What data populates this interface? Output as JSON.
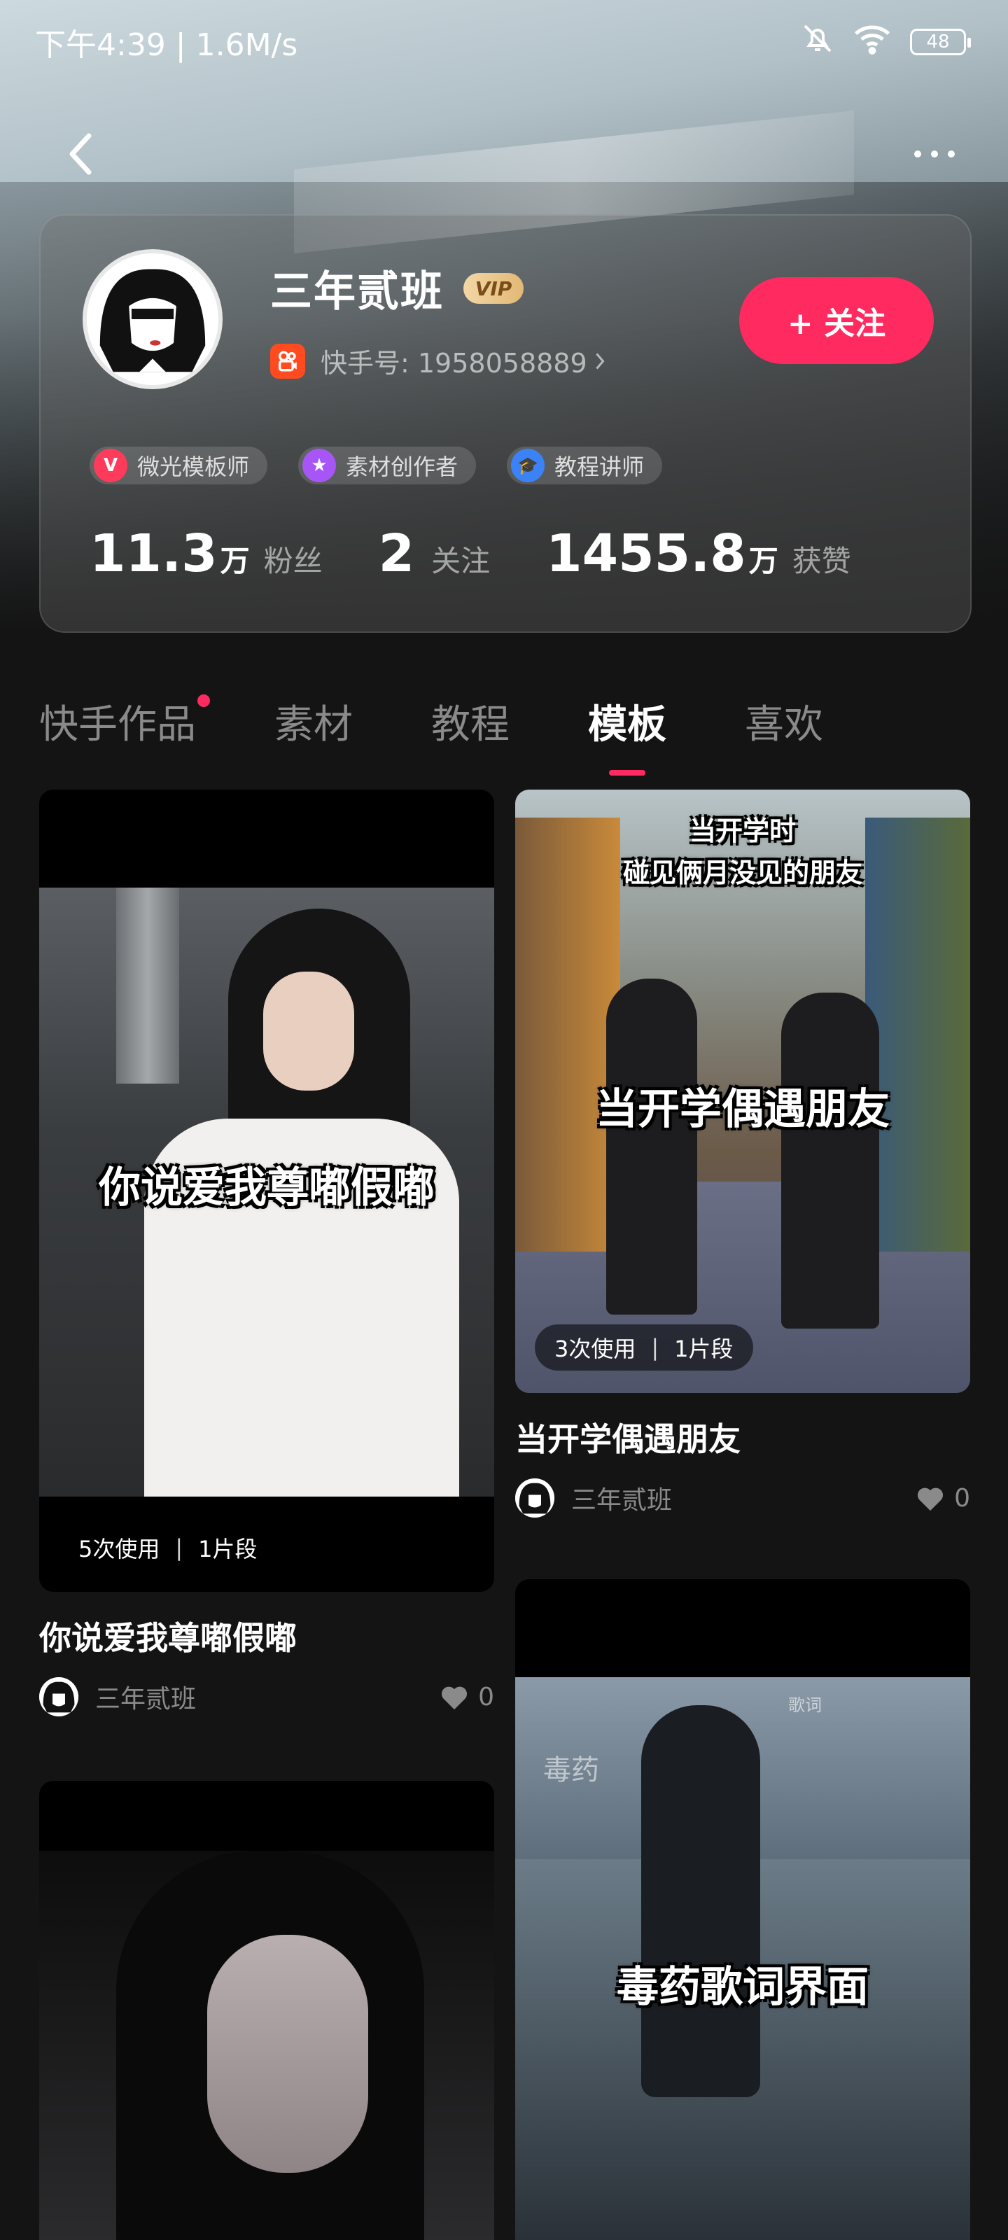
{
  "status_bar": {
    "time": "下午4:39 | 1.6M/s",
    "battery": "48"
  },
  "profile": {
    "name": "三年贰班",
    "vip": "VIP",
    "id_text": "快手号: 1958058889",
    "follow_label": "+ 关注",
    "badges": [
      {
        "label": "微光模板师",
        "icon": "V",
        "color": "#ff3b5c"
      },
      {
        "label": "素材创作者",
        "icon": "★",
        "color": "#a855f7"
      },
      {
        "label": "教程讲师",
        "icon": "🎓",
        "color": "#3b82f6"
      }
    ],
    "stats": [
      {
        "num": "11.3",
        "unit": "万",
        "label": "粉丝"
      },
      {
        "num": "2",
        "unit": "",
        "label": "关注"
      },
      {
        "num": "1455.8",
        "unit": "万",
        "label": "获赞"
      }
    ]
  },
  "tabs": [
    {
      "label": "快手作品",
      "active": false,
      "dot": true
    },
    {
      "label": "素材",
      "active": false,
      "dot": false
    },
    {
      "label": "教程",
      "active": false,
      "dot": false
    },
    {
      "label": "模板",
      "active": true,
      "dot": false
    },
    {
      "label": "喜欢",
      "active": false,
      "dot": false
    }
  ],
  "cards": [
    {
      "caption": "你说爱我尊嘟假嘟",
      "uses": "5次使用",
      "segments": "1片段",
      "title": "你说爱我尊嘟假嘟",
      "author": "三年贰班",
      "likes": "0"
    },
    {
      "caption": "当开学偶遇朋友",
      "top_caption_1": "当开学时",
      "top_caption_2": "碰见俩月没见的朋友",
      "uses": "3次使用",
      "segments": "1片段",
      "title": "当开学偶遇朋友",
      "author": "三年贰班",
      "likes": "0"
    },
    {
      "caption": "",
      "title": "",
      "author": "",
      "likes": ""
    },
    {
      "caption": "毒药歌词界面",
      "song_title": "毒药",
      "lyric_tab": "歌词"
    }
  ]
}
